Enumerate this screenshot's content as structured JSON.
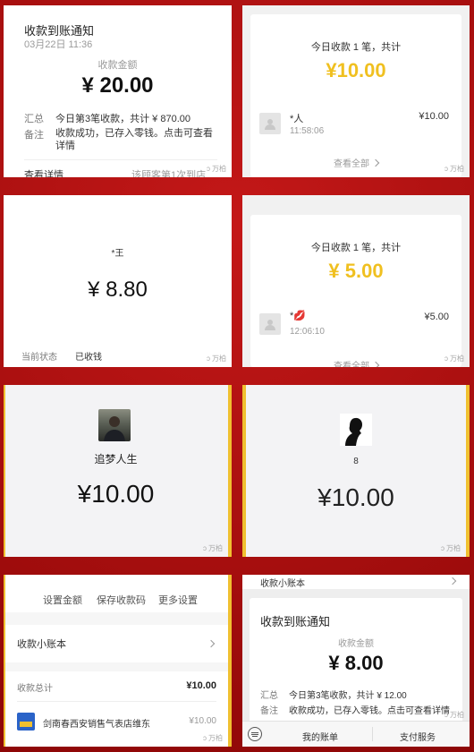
{
  "p1": {
    "title": "收款到账通知",
    "date": "03月22日 11:36",
    "amount_label": "收款金额",
    "amount": "¥ 20.00",
    "summary_label": "汇总",
    "summary_value": "今日第3笔收款，共计 ¥ 870.00",
    "remark_label": "备注",
    "remark_value": "收款成功，已存入零钱。点击可查看详情",
    "view_details": "查看详情",
    "customer_note": "该顾客第1次到店",
    "watermark": "万柏"
  },
  "p2": {
    "today_text": "今日收款 1 笔，共计",
    "amount": "¥10.00",
    "payer_name": "*人",
    "payer_amount": "¥10.00",
    "payer_time": "11:58:06",
    "view_all": "查看全部",
    "watermark": "万柏"
  },
  "p3": {
    "name": "*王",
    "amount": "¥ 8.80",
    "status_label": "当前状态",
    "status_value": "已收钱",
    "watermark": "万柏"
  },
  "p4": {
    "today_text": "今日收款 1 笔，共计",
    "amount": "¥ 5.00",
    "payer_name": "*💋",
    "payer_amount": "¥5.00",
    "payer_time": "12:06:10",
    "view_all": "查看全部",
    "watermark": "万柏"
  },
  "p5": {
    "name": "追梦人生",
    "amount": "¥10.00",
    "watermark": "万柏"
  },
  "p6": {
    "name": "8",
    "amount": "¥10.00",
    "watermark": "万柏"
  },
  "p7": {
    "action1": "设置金额",
    "action2": "保存收款码",
    "action3": "更多设置",
    "ledger_label": "收款小账本",
    "total_label": "收款总计",
    "total_value": "¥10.00",
    "merchant_name": "剑南春西安销售气表店维东",
    "merchant_amount": "¥10.00",
    "watermark": "万柏"
  },
  "p8": {
    "ledger_label": "收款小账本",
    "title": "收款到账通知",
    "amount_label": "收款金额",
    "amount": "¥ 8.00",
    "summary_label": "汇总",
    "summary_value": "今日第3笔收款，共计 ¥ 12.00",
    "remark_label": "备注",
    "remark_value": "收款成功，已存入零钱。点击可查看详情",
    "tab1": "我的账单",
    "tab2": "支付服务",
    "watermark": "万柏"
  }
}
